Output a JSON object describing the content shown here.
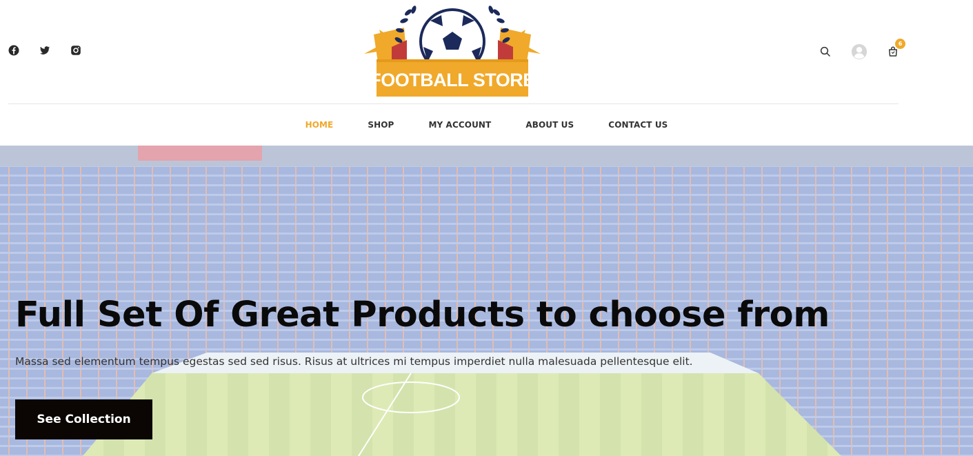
{
  "header": {
    "social": [
      {
        "icon": "facebook-icon"
      },
      {
        "icon": "twitter-icon"
      },
      {
        "icon": "instagram-icon"
      }
    ],
    "logo": {
      "text": "FOOTBALL STORE",
      "colors": {
        "banner": "#f0a92a",
        "navy": "#1b2a5b",
        "red": "#c23b3b"
      }
    },
    "actions": {
      "search_icon": "search-icon",
      "account_icon": "user-avatar-icon",
      "cart_icon": "shopping-bag-icon",
      "cart_count": "6"
    }
  },
  "nav": {
    "items": [
      {
        "label": "HOME",
        "active": true
      },
      {
        "label": "SHOP",
        "active": false
      },
      {
        "label": "MY ACCOUNT",
        "active": false
      },
      {
        "label": "ABOUT US",
        "active": false
      },
      {
        "label": "CONTACT US",
        "active": false
      }
    ]
  },
  "hero": {
    "title": "Full Set Of Great Products to choose from",
    "subtitle": "Massa sed elementum tempus egestas sed sed risus. Risus at ultrices mi tempus imperdiet nulla malesuada pellentesque elit.",
    "cta_label": "See Collection"
  },
  "colors": {
    "accent": "#f0a92a",
    "cta_bg": "#0b0604",
    "text_dark": "#0a0a0a"
  }
}
